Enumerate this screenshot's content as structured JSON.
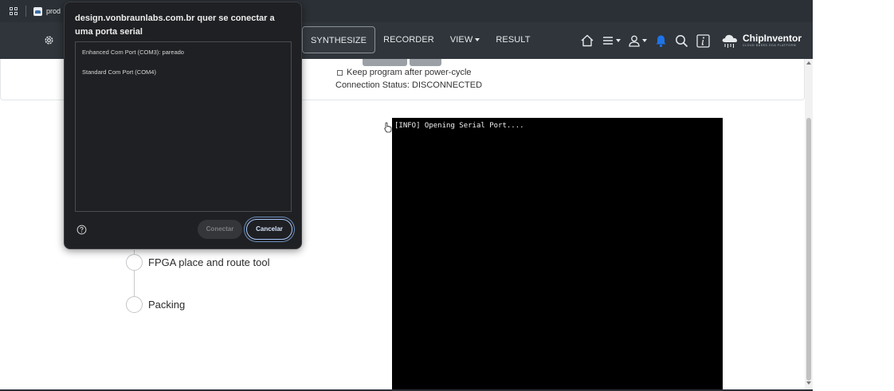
{
  "browser": {
    "tab_label": "prod"
  },
  "navbar": {
    "items": [
      {
        "label": "SYNTHESIZE",
        "active": true
      },
      {
        "label": "RECORDER",
        "active": false
      },
      {
        "label": "VIEW",
        "active": false,
        "dropdown": true
      },
      {
        "label": "RESULT",
        "active": false
      }
    ],
    "icons": [
      "home-icon",
      "menu-icon",
      "user-icon",
      "bell-icon",
      "search-icon",
      "info-icon"
    ],
    "brand": {
      "name": "ChipInventor",
      "tagline": "CLOUD BASED EDA PLATFORM"
    },
    "colors": {
      "background": "#2f353b",
      "bell": "#1e73e8"
    }
  },
  "program": {
    "keep_program_label": "Keep program after power-cycle",
    "keep_program_checked": false,
    "connection_status": "Connection Status: DISCONNECTED"
  },
  "terminal": {
    "lines": [
      "[INFO] Opening Serial Port...."
    ]
  },
  "flow_steps": [
    {
      "label": "FPGA place and route tool"
    },
    {
      "label": "Packing"
    }
  ],
  "dialog": {
    "title": "design.vonbraunlabs.com.br quer se conectar a uma porta serial",
    "ports": [
      "Enhanced Com Port (COM3): pareado",
      "Standard Com Port (COM4)"
    ],
    "connect_label": "Conectar",
    "cancel_label": "Cancelar",
    "connect_enabled": false
  }
}
